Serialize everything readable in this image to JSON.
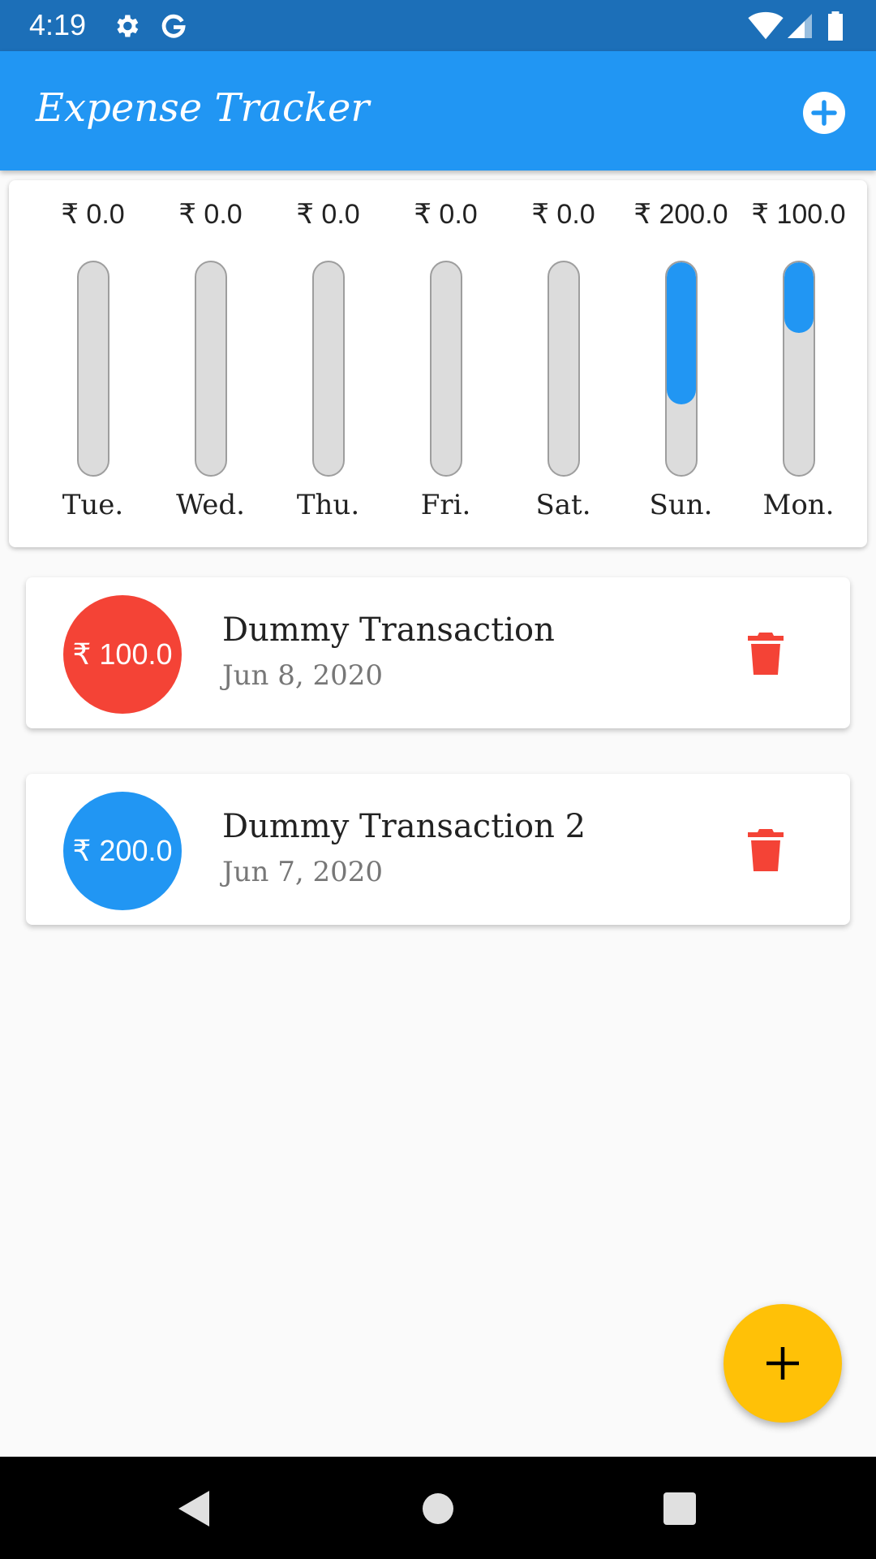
{
  "status_bar": {
    "time": "4:19",
    "icons": [
      "gear-icon",
      "google-g-icon",
      "wifi-icon",
      "signal-icon",
      "battery-icon"
    ]
  },
  "app_bar": {
    "title": "Expense Tracker",
    "add_icon": "add-circle-icon"
  },
  "chart_data": {
    "type": "bar",
    "categories": [
      "Tue.",
      "Wed.",
      "Thu.",
      "Fri.",
      "Sat.",
      "Sun.",
      "Mon."
    ],
    "values": [
      0.0,
      0.0,
      0.0,
      0.0,
      0.0,
      200.0,
      100.0
    ],
    "labels": [
      "₹ 0.0",
      "₹ 0.0",
      "₹ 0.0",
      "₹ 0.0",
      "₹ 0.0",
      "₹ 200.0",
      "₹ 100.0"
    ],
    "fill_fraction": [
      0,
      0,
      0,
      0,
      0,
      0.667,
      0.333
    ],
    "colors": {
      "fill": "#2196f3",
      "track": "#dcdcdc"
    }
  },
  "transactions": [
    {
      "amount": "₹ 100.0",
      "title": "Dummy Transaction",
      "date": "Jun 8, 2020",
      "color": "#f44336"
    },
    {
      "amount": "₹ 200.0",
      "title": "Dummy Transaction 2",
      "date": "Jun 7, 2020",
      "color": "#2196f3"
    }
  ],
  "fab": {
    "icon": "plus-icon",
    "color": "#ffc107"
  },
  "nav_bar": {
    "icons": [
      "back-icon",
      "home-icon",
      "recents-icon"
    ]
  }
}
